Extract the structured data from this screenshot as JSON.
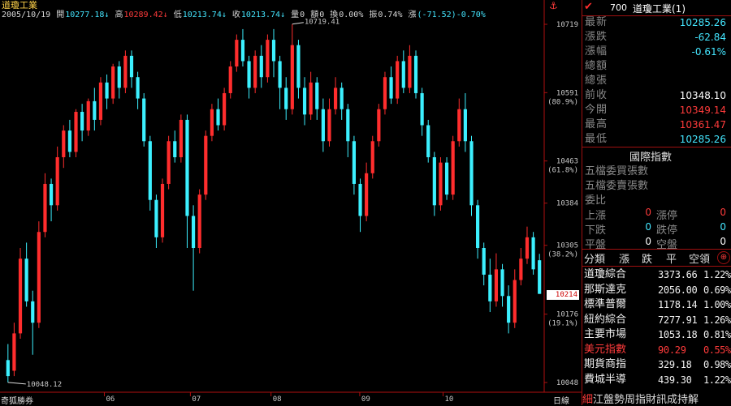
{
  "header": {
    "title": "道瓊工業",
    "date": "2005/10/19",
    "open_label": "開",
    "open": "10277.18↓",
    "high_label": "高",
    "high": "10289.42↓",
    "low_label": "低",
    "low": "10213.74↓",
    "close_label": "收",
    "close": "10213.74↓",
    "vol_label": "量",
    "vol": "0",
    "amt_label": "額",
    "amt": "0",
    "turn_label": "換",
    "turn": "0.00%",
    "amp_label": "振",
    "amp": "0.74%",
    "chg_label": "漲",
    "chg": "(-71.52)-0.70%"
  },
  "chart": {
    "price_labels": [
      "10719",
      "10591",
      "10463",
      "10384",
      "10305",
      "10176",
      "10048"
    ],
    "pct_labels": [
      "(80.9%)",
      "(61.8%)",
      "(38.2%)",
      "(19.1%)"
    ],
    "month_labels": [
      "06",
      "07",
      "08",
      "09",
      "10"
    ],
    "high_annotation": "10719.41",
    "low_annotation": "10048.12",
    "last_price": "10214",
    "anchor_icon": "anchor-icon"
  },
  "chart_data": {
    "type": "candlestick",
    "series_note": "",
    "y_range": [
      10048,
      10719
    ],
    "x_ticks": [
      "06",
      "07",
      "08",
      "09",
      "10"
    ],
    "candles": [
      {
        "o": 10090,
        "c": 10060,
        "h": 10120,
        "l": 10048
      },
      {
        "o": 10070,
        "c": 10140,
        "h": 10160,
        "l": 10060
      },
      {
        "o": 10140,
        "c": 10280,
        "h": 10300,
        "l": 10130
      },
      {
        "o": 10280,
        "c": 10200,
        "h": 10310,
        "l": 10190
      },
      {
        "o": 10200,
        "c": 10160,
        "h": 10220,
        "l": 10100
      },
      {
        "o": 10160,
        "c": 10330,
        "h": 10350,
        "l": 10150
      },
      {
        "o": 10330,
        "c": 10420,
        "h": 10440,
        "l": 10320
      },
      {
        "o": 10420,
        "c": 10380,
        "h": 10430,
        "l": 10350
      },
      {
        "o": 10380,
        "c": 10470,
        "h": 10490,
        "l": 10370
      },
      {
        "o": 10470,
        "c": 10520,
        "h": 10530,
        "l": 10450
      },
      {
        "o": 10520,
        "c": 10480,
        "h": 10540,
        "l": 10470
      },
      {
        "o": 10480,
        "c": 10555,
        "h": 10560,
        "l": 10470
      },
      {
        "o": 10555,
        "c": 10520,
        "h": 10570,
        "l": 10500
      },
      {
        "o": 10520,
        "c": 10575,
        "h": 10580,
        "l": 10510
      },
      {
        "o": 10575,
        "c": 10540,
        "h": 10600,
        "l": 10520
      },
      {
        "o": 10540,
        "c": 10610,
        "h": 10620,
        "l": 10530
      },
      {
        "o": 10610,
        "c": 10580,
        "h": 10625,
        "l": 10560
      },
      {
        "o": 10580,
        "c": 10640,
        "h": 10645,
        "l": 10570
      },
      {
        "o": 10640,
        "c": 10600,
        "h": 10650,
        "l": 10580
      },
      {
        "o": 10600,
        "c": 10660,
        "h": 10670,
        "l": 10590
      },
      {
        "o": 10660,
        "c": 10620,
        "h": 10670,
        "l": 10600
      },
      {
        "o": 10620,
        "c": 10580,
        "h": 10630,
        "l": 10560
      },
      {
        "o": 10580,
        "c": 10500,
        "h": 10590,
        "l": 10490
      },
      {
        "o": 10500,
        "c": 10390,
        "h": 10510,
        "l": 10370
      },
      {
        "o": 10390,
        "c": 10320,
        "h": 10400,
        "l": 10300
      },
      {
        "o": 10320,
        "c": 10420,
        "h": 10430,
        "l": 10310
      },
      {
        "o": 10420,
        "c": 10500,
        "h": 10510,
        "l": 10410
      },
      {
        "o": 10500,
        "c": 10470,
        "h": 10520,
        "l": 10460
      },
      {
        "o": 10470,
        "c": 10540,
        "h": 10550,
        "l": 10460
      },
      {
        "o": 10540,
        "c": 10360,
        "h": 10550,
        "l": 10300
      },
      {
        "o": 10360,
        "c": 10300,
        "h": 10380,
        "l": 10220
      },
      {
        "o": 10300,
        "c": 10400,
        "h": 10410,
        "l": 10290
      },
      {
        "o": 10400,
        "c": 10510,
        "h": 10520,
        "l": 10390
      },
      {
        "o": 10510,
        "c": 10560,
        "h": 10570,
        "l": 10500
      },
      {
        "o": 10560,
        "c": 10530,
        "h": 10580,
        "l": 10520
      },
      {
        "o": 10530,
        "c": 10590,
        "h": 10600,
        "l": 10520
      },
      {
        "o": 10590,
        "c": 10640,
        "h": 10650,
        "l": 10580
      },
      {
        "o": 10640,
        "c": 10690,
        "h": 10700,
        "l": 10630
      },
      {
        "o": 10690,
        "c": 10650,
        "h": 10710,
        "l": 10640
      },
      {
        "o": 10650,
        "c": 10600,
        "h": 10660,
        "l": 10580
      },
      {
        "o": 10600,
        "c": 10660,
        "h": 10670,
        "l": 10590
      },
      {
        "o": 10660,
        "c": 10620,
        "h": 10680,
        "l": 10600
      },
      {
        "o": 10620,
        "c": 10690,
        "h": 10700,
        "l": 10610
      },
      {
        "o": 10690,
        "c": 10650,
        "h": 10710,
        "l": 10620
      },
      {
        "o": 10650,
        "c": 10600,
        "h": 10660,
        "l": 10560
      },
      {
        "o": 10600,
        "c": 10560,
        "h": 10620,
        "l": 10540
      },
      {
        "o": 10560,
        "c": 10680,
        "h": 10719,
        "l": 10550
      },
      {
        "o": 10680,
        "c": 10600,
        "h": 10690,
        "l": 10580
      },
      {
        "o": 10600,
        "c": 10550,
        "h": 10620,
        "l": 10530
      },
      {
        "o": 10550,
        "c": 10610,
        "h": 10630,
        "l": 10540
      },
      {
        "o": 10610,
        "c": 10560,
        "h": 10620,
        "l": 10540
      },
      {
        "o": 10560,
        "c": 10500,
        "h": 10580,
        "l": 10480
      },
      {
        "o": 10500,
        "c": 10560,
        "h": 10580,
        "l": 10490
      },
      {
        "o": 10560,
        "c": 10600,
        "h": 10620,
        "l": 10550
      },
      {
        "o": 10600,
        "c": 10560,
        "h": 10610,
        "l": 10540
      },
      {
        "o": 10560,
        "c": 10500,
        "h": 10570,
        "l": 10470
      },
      {
        "o": 10500,
        "c": 10420,
        "h": 10510,
        "l": 10400
      },
      {
        "o": 10420,
        "c": 10360,
        "h": 10430,
        "l": 10330
      },
      {
        "o": 10360,
        "c": 10440,
        "h": 10460,
        "l": 10350
      },
      {
        "o": 10440,
        "c": 10500,
        "h": 10510,
        "l": 10430
      },
      {
        "o": 10500,
        "c": 10560,
        "h": 10570,
        "l": 10490
      },
      {
        "o": 10560,
        "c": 10620,
        "h": 10630,
        "l": 10550
      },
      {
        "o": 10620,
        "c": 10580,
        "h": 10640,
        "l": 10570
      },
      {
        "o": 10580,
        "c": 10650,
        "h": 10660,
        "l": 10570
      },
      {
        "o": 10650,
        "c": 10600,
        "h": 10670,
        "l": 10590
      },
      {
        "o": 10600,
        "c": 10660,
        "h": 10680,
        "l": 10590
      },
      {
        "o": 10660,
        "c": 10590,
        "h": 10670,
        "l": 10580
      },
      {
        "o": 10590,
        "c": 10530,
        "h": 10600,
        "l": 10510
      },
      {
        "o": 10530,
        "c": 10470,
        "h": 10540,
        "l": 10460
      },
      {
        "o": 10470,
        "c": 10380,
        "h": 10480,
        "l": 10360
      },
      {
        "o": 10380,
        "c": 10460,
        "h": 10470,
        "l": 10370
      },
      {
        "o": 10460,
        "c": 10400,
        "h": 10470,
        "l": 10390
      },
      {
        "o": 10400,
        "c": 10500,
        "h": 10510,
        "l": 10390
      },
      {
        "o": 10500,
        "c": 10560,
        "h": 10580,
        "l": 10490
      },
      {
        "o": 10560,
        "c": 10500,
        "h": 10590,
        "l": 10480
      },
      {
        "o": 10500,
        "c": 10380,
        "h": 10510,
        "l": 10360
      },
      {
        "o": 10380,
        "c": 10300,
        "h": 10390,
        "l": 10280
      },
      {
        "o": 10300,
        "c": 10250,
        "h": 10310,
        "l": 10230
      },
      {
        "o": 10250,
        "c": 10200,
        "h": 10280,
        "l": 10180
      },
      {
        "o": 10200,
        "c": 10260,
        "h": 10290,
        "l": 10190
      },
      {
        "o": 10260,
        "c": 10210,
        "h": 10270,
        "l": 10190
      },
      {
        "o": 10210,
        "c": 10160,
        "h": 10230,
        "l": 10140
      },
      {
        "o": 10160,
        "c": 10240,
        "h": 10260,
        "l": 10150
      },
      {
        "o": 10240,
        "c": 10280,
        "h": 10300,
        "l": 10230
      },
      {
        "o": 10280,
        "c": 10320,
        "h": 10340,
        "l": 10270
      },
      {
        "o": 10320,
        "c": 10260,
        "h": 10330,
        "l": 10250
      },
      {
        "o": 10277,
        "c": 10214,
        "h": 10289,
        "l": 10214
      }
    ],
    "up_color": "#ff2d2d",
    "down_color": "#3cf0ff"
  },
  "footer": {
    "broker": "奇狐勝券",
    "day_label": "日線"
  },
  "panel": {
    "code": "700",
    "name": "道瓊工業(1)",
    "quotes": [
      {
        "label": "最新",
        "value": "10285.26",
        "color": "#44e6ff"
      },
      {
        "label": "漲跌",
        "value": "-62.84",
        "color": "#44e6ff"
      },
      {
        "label": "漲幅",
        "value": "-0.61%",
        "color": "#44e6ff"
      },
      {
        "label": "總額",
        "value": "",
        "color": "#fff"
      },
      {
        "label": "總張",
        "value": "",
        "color": "#fff"
      },
      {
        "label": "前收",
        "value": "10348.10",
        "color": "#ffffff"
      },
      {
        "label": "今開",
        "value": "10349.14",
        "color": "#ff3b3b"
      },
      {
        "label": "最高",
        "value": "10361.47",
        "color": "#ff3b3b"
      },
      {
        "label": "最低",
        "value": "10285.26",
        "color": "#44e6ff"
      }
    ],
    "intl_title": "國際指數",
    "sub_rows": [
      "五檔委買張數",
      "五檔委賣張數",
      "委比"
    ],
    "updown": [
      {
        "l1": "上漲",
        "v1": "0",
        "c1": "#ff3b3b",
        "l2": "漲停",
        "v2": "0",
        "c2": "#ff3b3b"
      },
      {
        "l1": "下跌",
        "v1": "0",
        "c1": "#44e6ff",
        "l2": "跌停",
        "v2": "0",
        "c2": "#44e6ff"
      },
      {
        "l1": "平盤",
        "v1": "0",
        "c1": "#ffffff",
        "l2": "空盤",
        "v2": "0",
        "c2": "#ffffff"
      }
    ],
    "cats": [
      "分類",
      "漲",
      "跌",
      "平",
      "空領"
    ],
    "indices": [
      {
        "name": "道瓊綜合",
        "price": "3373.66",
        "diff": "1.22%",
        "red": false
      },
      {
        "name": "那斯達克",
        "price": "2056.00",
        "diff": "0.69%",
        "red": false
      },
      {
        "name": "標準普爾",
        "price": "1178.14",
        "diff": "1.00%",
        "red": false
      },
      {
        "name": "紐約綜合",
        "price": "7277.91",
        "diff": "1.26%",
        "red": false
      },
      {
        "name": "主要市場",
        "price": "1053.18",
        "diff": "0.81%",
        "red": false
      },
      {
        "name": "美元指數",
        "price": "90.29",
        "diff": "0.55%",
        "red": true
      },
      {
        "name": "期貨商指",
        "price": "329.18",
        "diff": "0.98%",
        "red": false
      },
      {
        "name": "費城半導",
        "price": "439.30",
        "diff": "1.22%",
        "red": false
      }
    ],
    "ticker_mark": "細",
    "ticker": "江盤勢周指財訊成持解"
  }
}
